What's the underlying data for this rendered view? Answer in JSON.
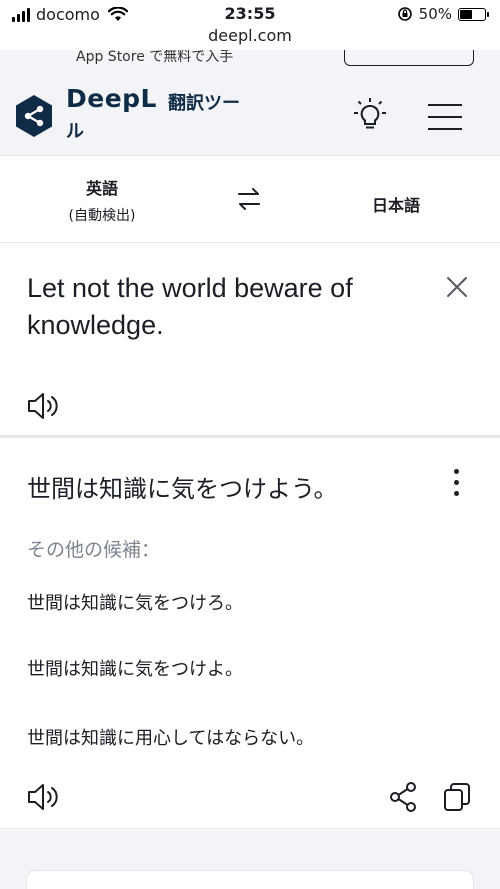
{
  "status_bar": {
    "carrier": "docomo",
    "time": "23:55",
    "battery_text": "50%",
    "battery_level": 0.5,
    "url": "deepl.com"
  },
  "app_banner": {
    "text": "App Store で無料で入手"
  },
  "header": {
    "brand": "DeepL",
    "subtitle": "翻訳ツール",
    "icons": [
      "deepl-logo",
      "lightbulb-icon",
      "menu-icon"
    ]
  },
  "languages": {
    "source": "英語",
    "source_detect": "(自動検出)",
    "target": "日本語"
  },
  "source": {
    "text": "Let not the world beware of knowledge."
  },
  "target": {
    "translation": "世間は知識に気をつけよう。",
    "alternatives_heading": "その他の候補：",
    "alternatives": [
      "世間は知識に気をつけろ。",
      "世間は知識に気をつけよ。",
      "世間は知識に用心してはならない。"
    ]
  },
  "colors": {
    "brand_navy": "#0f2b46",
    "text": "#1b1e25",
    "muted": "#7d8590",
    "header_bg": "#f2f4f7"
  }
}
